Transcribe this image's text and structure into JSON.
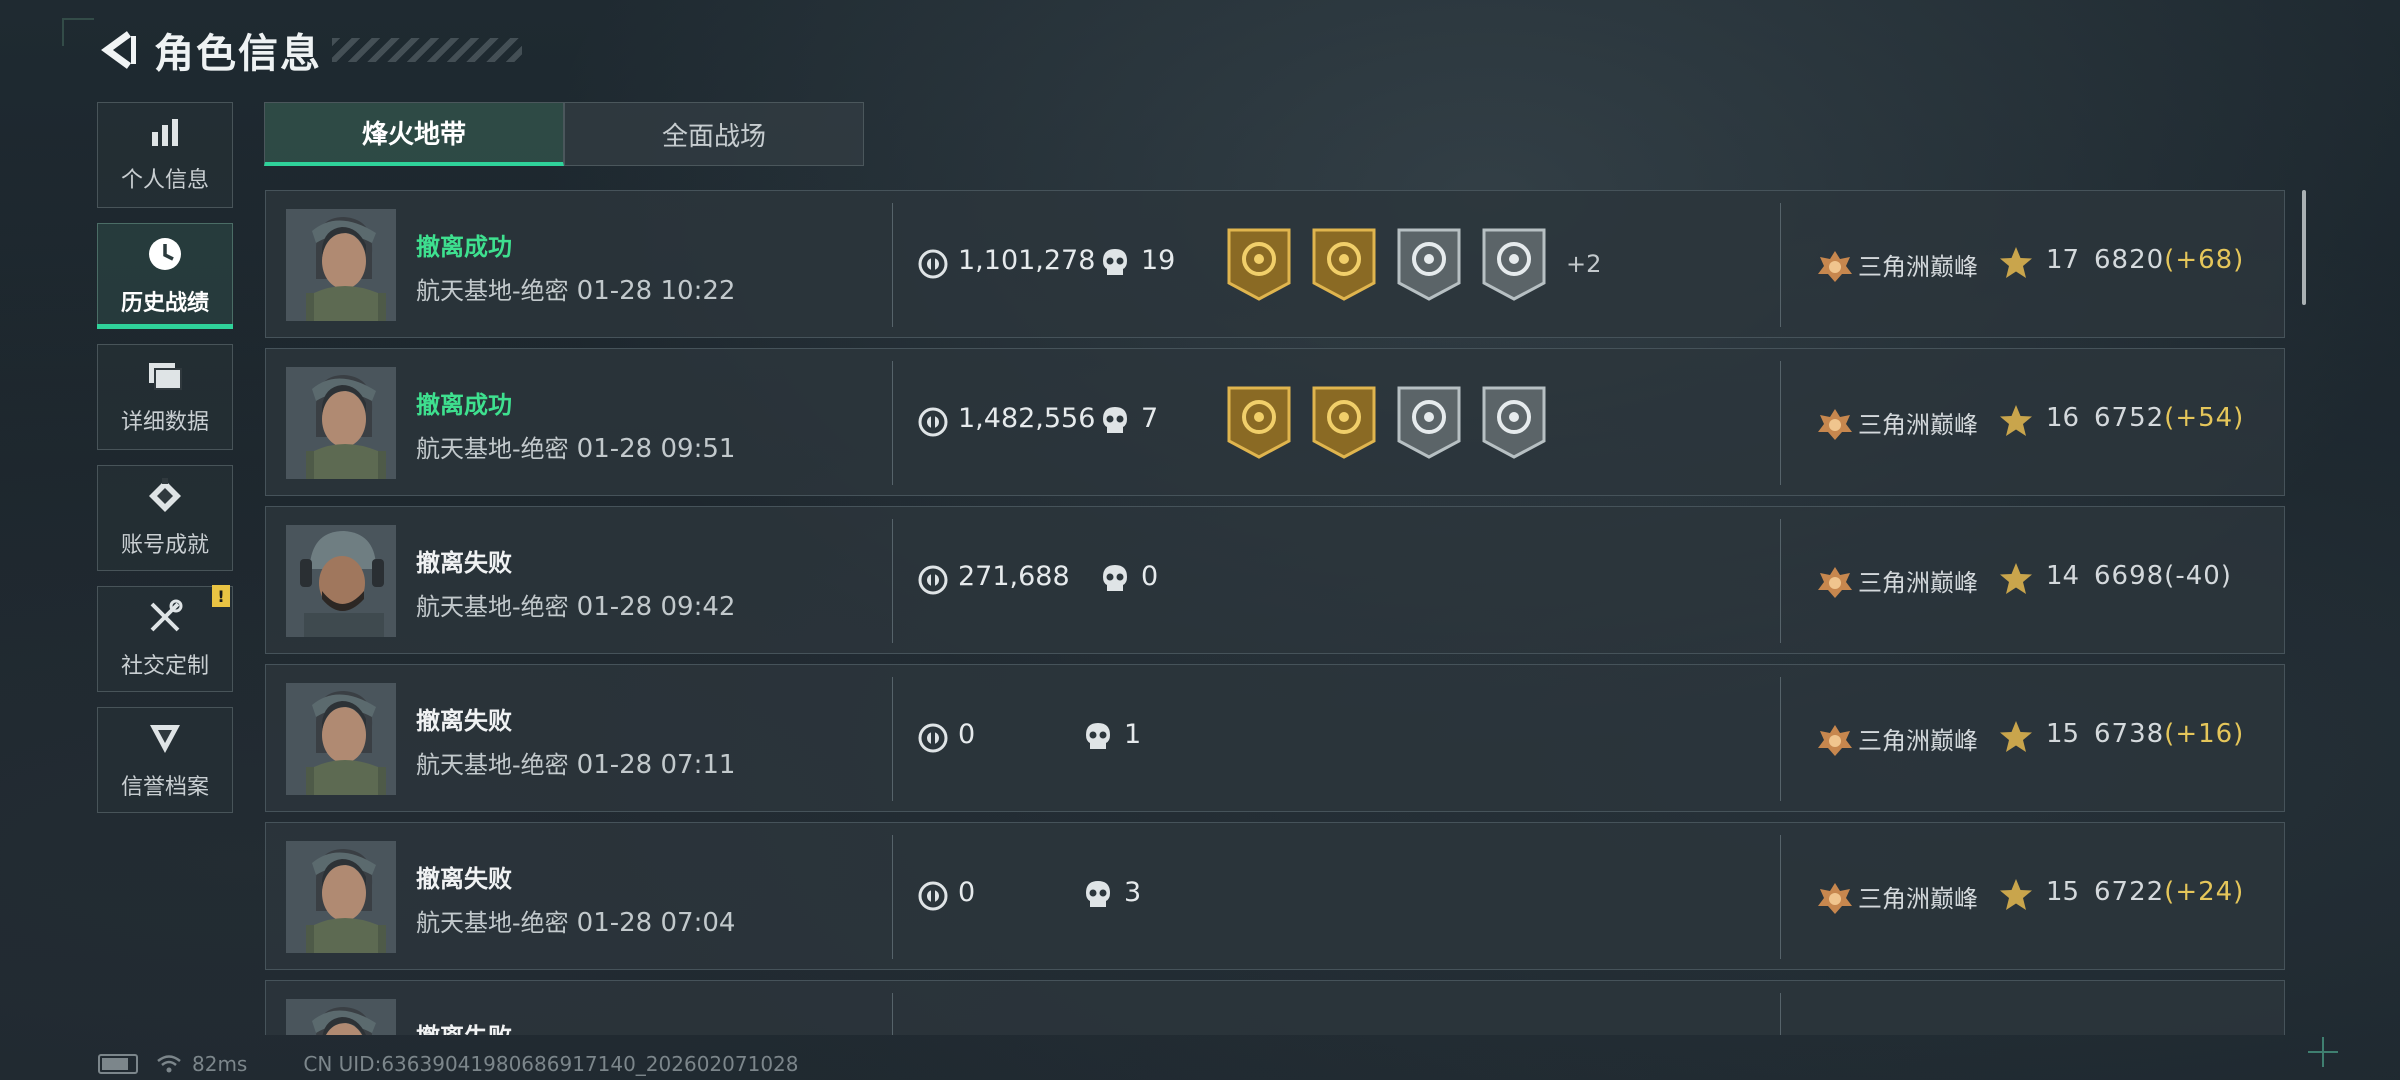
{
  "header": {
    "title": "角色信息"
  },
  "sidebar": {
    "items": [
      {
        "label": "个人信息",
        "icon": "bar-chart-icon"
      },
      {
        "label": "历史战绩",
        "icon": "clock-icon",
        "active": true
      },
      {
        "label": "详细数据",
        "icon": "folder-icon"
      },
      {
        "label": "账号成就",
        "icon": "achievement-icon"
      },
      {
        "label": "社交定制",
        "icon": "wrench-icon",
        "badge": "!"
      },
      {
        "label": "信誉档案",
        "icon": "shield-icon"
      }
    ]
  },
  "tabs": [
    {
      "label": "烽火地带",
      "active": true
    },
    {
      "label": "全面战场",
      "active": false
    }
  ],
  "records": [
    {
      "result": "撤离成功",
      "status": "success",
      "map": "航天基地-绝密",
      "time": "01-28 10:22",
      "money": "1,101,278",
      "kills": "19",
      "badges": [
        "badge-gold-rank",
        "badge-gold-coin",
        "badge-silver-target",
        "badge-silver-crosshair"
      ],
      "more": "+2",
      "rank": "三角洲巅峰",
      "level": "17",
      "score": "6820",
      "delta": "(+68)",
      "avatar": "female-operator"
    },
    {
      "result": "撤离成功",
      "status": "success",
      "map": "航天基地-绝密",
      "time": "01-28 09:51",
      "money": "1,482,556",
      "kills": "7",
      "badges": [
        "badge-gold-coin",
        "badge-gold-scope",
        "badge-silver-burst",
        "badge-silver-hand"
      ],
      "more": "",
      "rank": "三角洲巅峰",
      "level": "16",
      "score": "6752",
      "delta": "(+54)",
      "avatar": "female-operator"
    },
    {
      "result": "撤离失败",
      "status": "fail",
      "map": "航天基地-绝密",
      "time": "01-28 09:42",
      "money": "271,688",
      "kills": "0",
      "badges": [],
      "more": "",
      "rank": "三角洲巅峰",
      "level": "14",
      "score": "6698",
      "delta": "(-40)",
      "avatar": "male-operator"
    },
    {
      "result": "撤离失败",
      "status": "fail",
      "map": "航天基地-绝密",
      "time": "01-28 07:11",
      "money": "0",
      "kills": "1",
      "badges": [],
      "more": "",
      "rank": "三角洲巅峰",
      "level": "15",
      "score": "6738",
      "delta": "(+16)",
      "avatar": "female-operator"
    },
    {
      "result": "撤离失败",
      "status": "fail",
      "map": "航天基地-绝密",
      "time": "01-28 07:04",
      "money": "0",
      "kills": "3",
      "badges": [],
      "more": "",
      "rank": "三角洲巅峰",
      "level": "15",
      "score": "6722",
      "delta": "(+24)",
      "avatar": "female-operator"
    },
    {
      "result": "撤离失败",
      "status": "fail",
      "map": "",
      "time": "",
      "money": "",
      "kills": "",
      "badges": [],
      "more": "",
      "rank": "",
      "level": "",
      "score": "",
      "delta": "",
      "avatar": "female-operator"
    }
  ],
  "statusbar": {
    "ping": "82ms",
    "uid": "CN UID:6363904198068691714​0_202602071028"
  },
  "colors": {
    "accent": "#2fd29a",
    "success": "#3ee08f",
    "gain": "#e5c65a",
    "notice": "#e9c343"
  }
}
